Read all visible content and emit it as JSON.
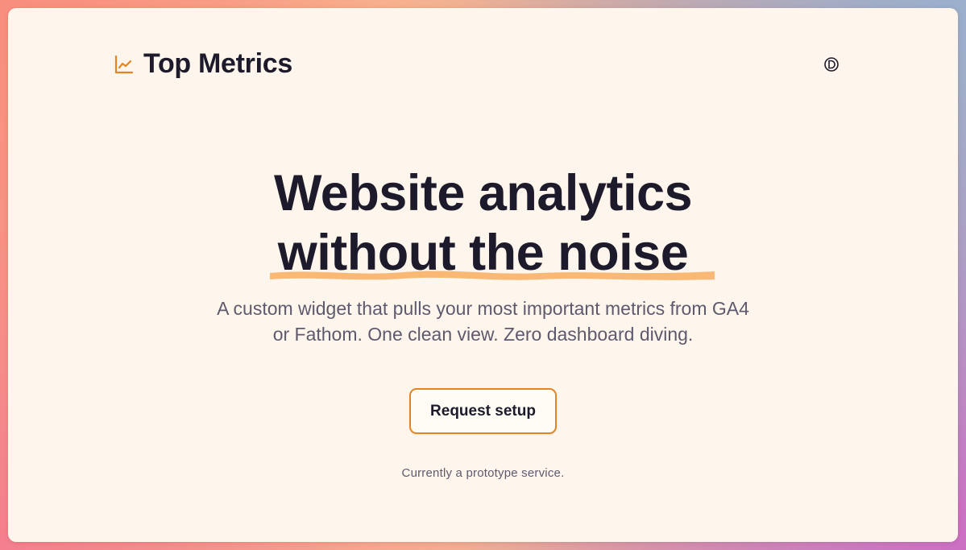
{
  "header": {
    "brand_name": "Top Metrics",
    "brand_icon": "line-chart-icon",
    "theme_toggle_icon": "theme-toggle-icon"
  },
  "hero": {
    "title_line1": "Website analytics",
    "title_line2": "without the noise",
    "subtitle_line1": "A custom widget that pulls your most important metrics from GA4",
    "subtitle_line2": "or Fathom. One clean view. Zero dashboard diving.",
    "cta_label": "Request setup",
    "note": "Currently a prototype service."
  },
  "colors": {
    "accent": "#e2841f",
    "highlight": "#f8b36a",
    "text_dark": "#1d1b2b",
    "text_muted": "#5e5a6e",
    "page_bg": "#fef5ec"
  }
}
